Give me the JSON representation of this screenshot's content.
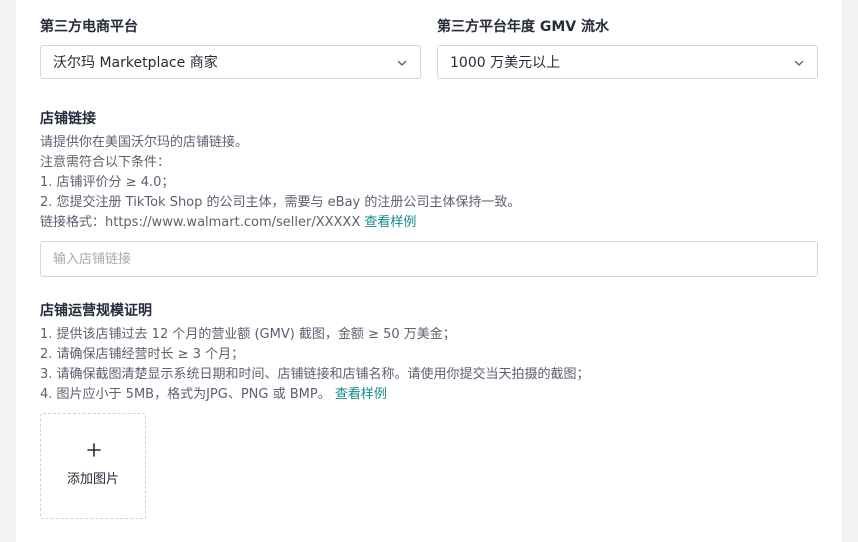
{
  "platform": {
    "label": "第三方电商平台",
    "value": "沃尔玛 Marketplace 商家"
  },
  "gmv": {
    "label": "第三方平台年度 GMV 流水",
    "value": "1000 万美元以上"
  },
  "store_link": {
    "label": "店铺链接",
    "lines": [
      "请提供你在美国沃尔玛的店铺链接。",
      "注意需符合以下条件：",
      "1. 店铺评价分 ≥ 4.0；",
      "2. 您提交注册 TikTok Shop 的公司主体，需要与 eBay 的注册公司主体保持一致。"
    ],
    "format_text": "链接格式：https://www.walmart.com/seller/XXXXX ",
    "example_link": "查看样例",
    "placeholder": "输入店铺链接"
  },
  "scale_proof": {
    "label": "店铺运营规模证明",
    "lines": [
      "1. 提供该店铺过去 12 个月的营业额 (GMV) 截图，金额 ≥ 50 万美金；",
      "2. 请确保店铺经营时长 ≥ 3 个月；",
      "3. 请确保截图清楚显示系统日期和时间、店铺链接和店铺名称。请使用你提交当天拍摄的截图；"
    ],
    "last_line_text": "4. 图片应小于 5MB，格式为JPG、PNG 或 BMP。 ",
    "example_link": "查看样例",
    "upload_label": "添加图片"
  },
  "colors": {
    "accent": "#138a8c",
    "border": "#d2d5dc",
    "background": "#f1f2f4"
  },
  "icons": {
    "select_arrow": "chevron-down-icon",
    "upload": "plus-icon"
  }
}
